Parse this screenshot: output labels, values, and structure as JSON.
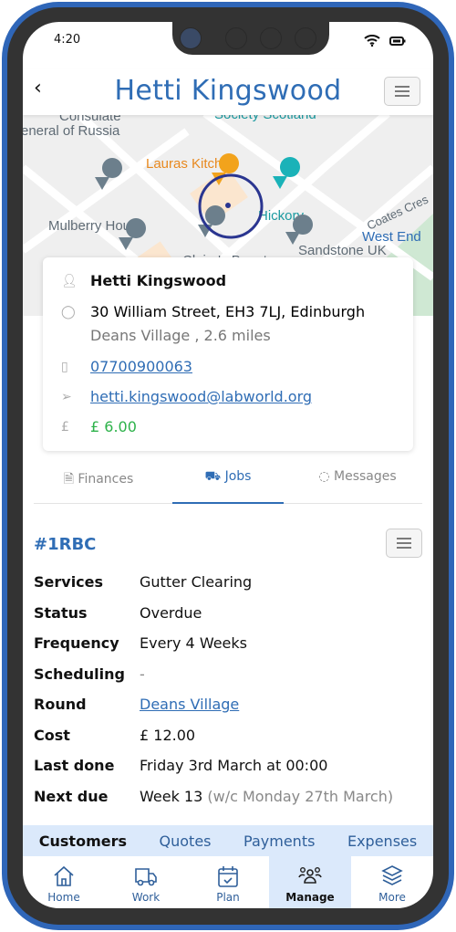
{
  "status": {
    "time": "4:20",
    "icons": [
      "wifi-icon",
      "battery-icon"
    ]
  },
  "header": {
    "title": "Hetti Kingswood",
    "back_icon": "chevron-left-icon",
    "menu_icon": "hamburger-icon"
  },
  "map": {
    "labels": [
      "Consulate",
      "eneral of Russia",
      "Society Scotland",
      "Lauras Kitchen",
      "Hickory",
      "Mulberry House",
      "Claire's Beauty",
      "Sandstone UK",
      "Coates Cres",
      "West End"
    ]
  },
  "contact": {
    "name": "Hetti Kingswood",
    "address": "30 William Street, EH3 7LJ, Edinburgh",
    "area": "Deans Village , 2.6 miles",
    "phone": "07700900063",
    "email": "hetti.kingswood@labworld.org",
    "balance": "£ 6.00"
  },
  "tabs": [
    {
      "label": "Finances",
      "icon": "document-icon"
    },
    {
      "label": "Jobs",
      "icon": "truck-icon",
      "active": true
    },
    {
      "label": "Messages",
      "icon": "chat-icon"
    }
  ],
  "job": {
    "id": "#1RBC",
    "rows": [
      {
        "key": "Services",
        "value": "Gutter Clearing"
      },
      {
        "key": "Status",
        "value": "Overdue"
      },
      {
        "key": "Frequency",
        "value": "Every 4 Weeks"
      },
      {
        "key": "Scheduling",
        "value": "-"
      },
      {
        "key": "Round",
        "value": "Deans Village"
      },
      {
        "key": "Cost",
        "value": "£ 12.00"
      },
      {
        "key": "Last done",
        "value": "Friday 3rd March at 00:00"
      },
      {
        "key": "Next due",
        "value": "Week 13",
        "extra": "(w/c Monday 27th March)"
      }
    ]
  },
  "subtabs": [
    "Customers",
    "Quotes",
    "Payments",
    "Expenses"
  ],
  "nav": [
    {
      "label": "Home"
    },
    {
      "label": "Work"
    },
    {
      "label": "Plan"
    },
    {
      "label": "Manage",
      "active": true
    },
    {
      "label": "More"
    }
  ],
  "colors": {
    "accent": "#2f6db5",
    "money": "#2db24a",
    "active_bg": "#dbe9fb",
    "frame": "#2f66b8"
  }
}
